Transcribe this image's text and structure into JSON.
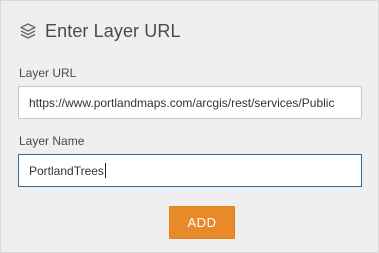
{
  "header": {
    "icon": "layers-icon",
    "title": "Enter Layer URL"
  },
  "form": {
    "url_label": "Layer URL",
    "url_value": "https://www.portlandmaps.com/arcgis/rest/services/Public",
    "name_label": "Layer Name",
    "name_value": "PortlandTrees",
    "add_label": "ADD"
  },
  "colors": {
    "panel_background": "#efefef",
    "accent_button": "#e8892a",
    "focused_input_border": "#2f6aa6"
  }
}
